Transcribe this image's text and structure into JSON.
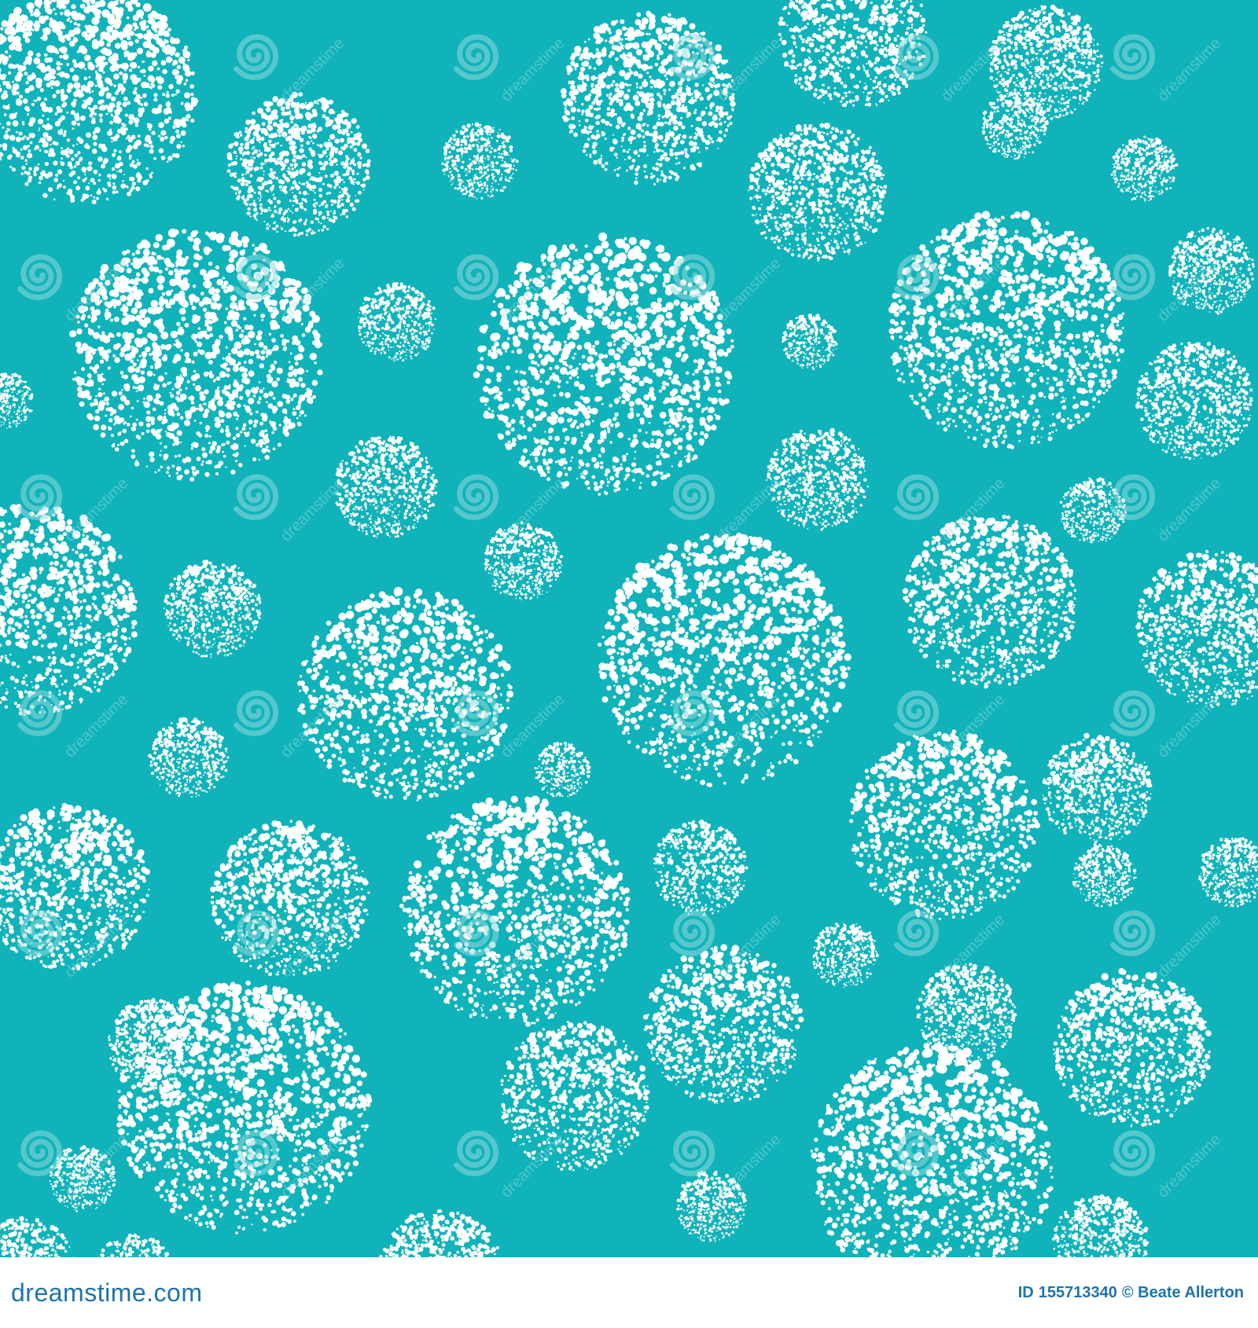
{
  "colors": {
    "background": "#10b3ba",
    "dots": "#ffffff",
    "watermark": "#8fd9dc",
    "footer_bg": "#ffffff",
    "footer_text": "#1d74ab"
  },
  "pattern": {
    "motif": "stippled-circles",
    "watermark_icon": "spiral-watermark-icon",
    "watermark_text": "dreamstime"
  },
  "footer": {
    "brand": "dreamstime.com",
    "id_label": "ID",
    "id_value": "155713340",
    "credit": "© Beate Allerton"
  }
}
